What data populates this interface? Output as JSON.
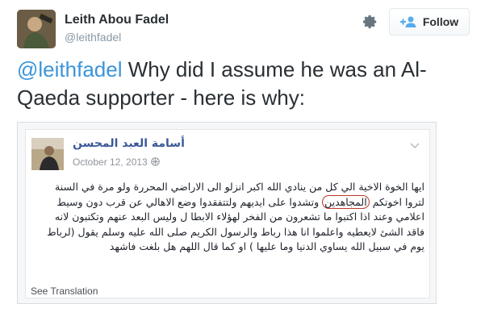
{
  "author": {
    "display_name": "Leith Abou Fadel",
    "screen_name": "@leithfadel"
  },
  "actions": {
    "follow_label": "Follow"
  },
  "tweet": {
    "mention": "@leithfadel",
    "text": " Why did I assume he was an Al-Qaeda supporter - here is why:"
  },
  "facebook_post": {
    "author_name": "أسامة العبد المحسن",
    "date": "October 12, 2013 ·",
    "body_part1": "ايها الخوة الاخية الي كل من ينادي الله اكبر انزلو الى الاراضي المحررة ولو مرة في السنة لتروا اخوتكم",
    "circled_word": "المجاهدين",
    "body_part2": "وتشدوا على ايديهم ولتتفقدوا وضع الاهالي عن قرب دون وسيط اعلامي وعند اذا اكتبوا ما تشعرون من الفخر لهؤلاء الابطا ل وليس البعد عنهم وتكتبون لانه فاقد الشئ لايعطيه واعلموا انا هذا رباط والرسول الكريم صلى الله عليه وسلم يقول (لرباط يوم في سبيل الله يساوي الدنيا وما عليها ) او كما قال اللهم هل بلغت فاشهد",
    "see_translation": "See Translation"
  }
}
